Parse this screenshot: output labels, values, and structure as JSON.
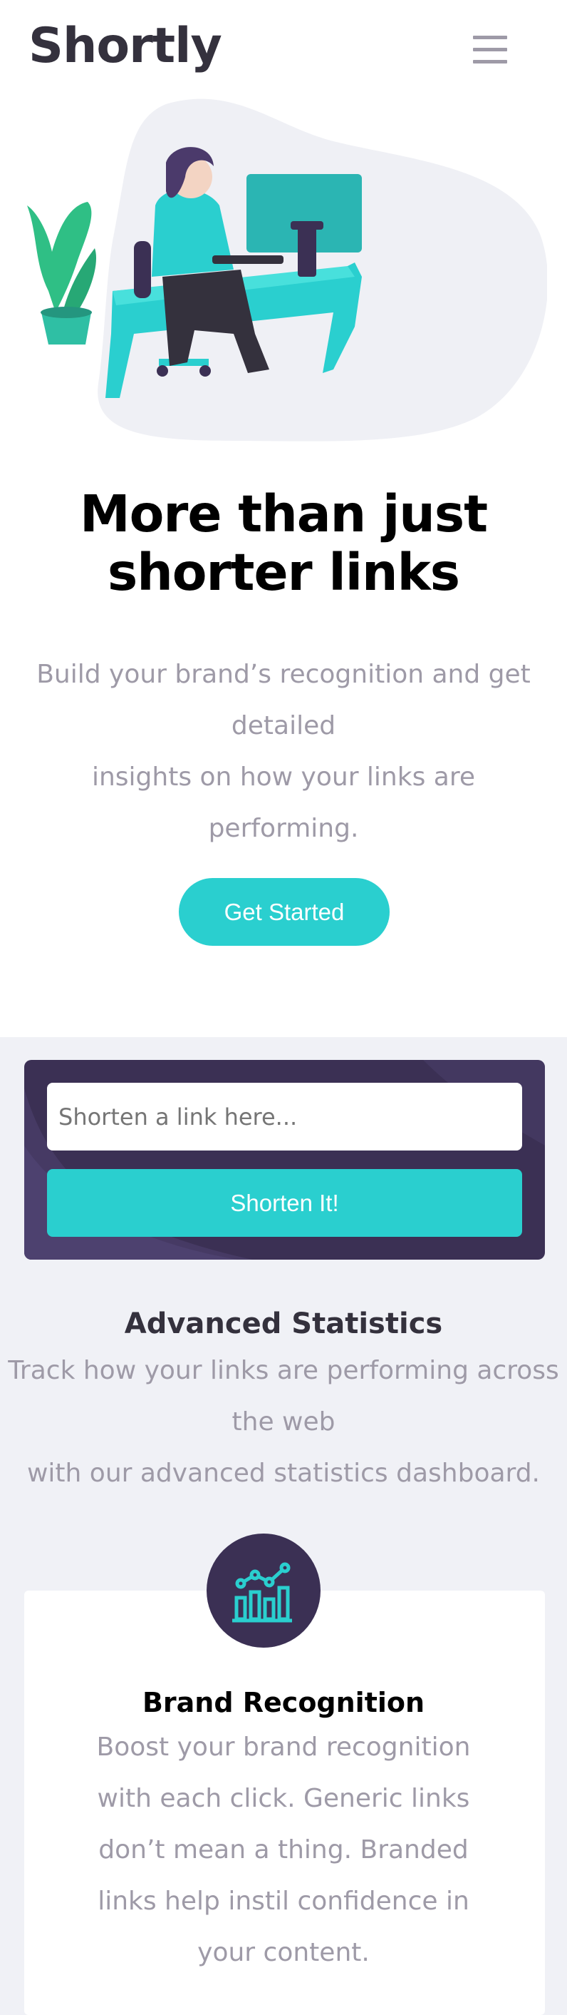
{
  "header": {
    "logo": "Shortly",
    "menu_icon": "hamburger-menu-icon"
  },
  "hero": {
    "title_line1": "More than just",
    "title_line2": "shorter links",
    "desc_line1": "Build your brand’s recognition and get",
    "desc_line2": "detailed",
    "desc_line3": "insights on how your links are",
    "desc_line4": "performing.",
    "cta_label": "Get Started"
  },
  "shortener": {
    "placeholder": "Shorten a link here...",
    "button_label": "Shorten It!"
  },
  "stats": {
    "title": "Advanced Statistics",
    "desc_line1": "Track how your links are performing across",
    "desc_line2": "the web",
    "desc_line3": "with our advanced statistics dashboard."
  },
  "card": {
    "icon": "brand-recognition-icon",
    "title": "Brand Recognition",
    "desc_line1": "Boost your brand recognition",
    "desc_line2": "with each click. Generic links",
    "desc_line3": "don’t mean a thing. Branded",
    "desc_line4": "links help instil confidence in",
    "desc_line5": "your content."
  },
  "colors": {
    "cyan": "#2acfcf",
    "dark_violet": "#3b3054",
    "grayish_violet": "#9e9aa7",
    "very_dark_blue": "#34313d",
    "light_gray": "#f0f1f6"
  }
}
